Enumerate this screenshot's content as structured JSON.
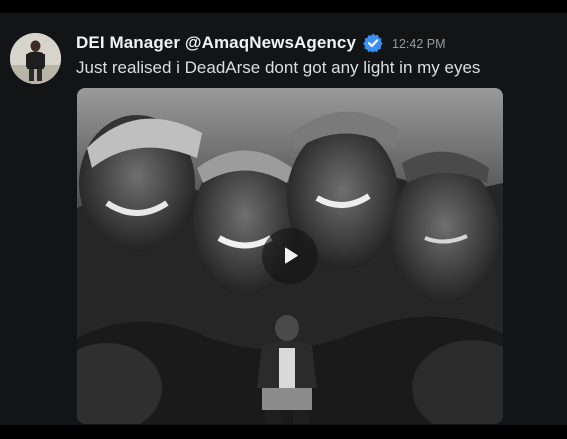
{
  "message": {
    "author": "DEI Manager @AmaqNewsAgency",
    "verified_icon": "verified-badge-icon",
    "timestamp": "12:42 PM",
    "text": "Just realised i DeadArse dont got any light in my eyes"
  },
  "media": {
    "type": "video",
    "play_icon": "play-icon",
    "description_icon": "video-thumbnail"
  },
  "colors": {
    "background": "#131416",
    "author_text": "#f2f3f5",
    "body_text": "#dbdee1",
    "timestamp_text": "#949ba4",
    "verified_blue": "#3a8ff2"
  }
}
